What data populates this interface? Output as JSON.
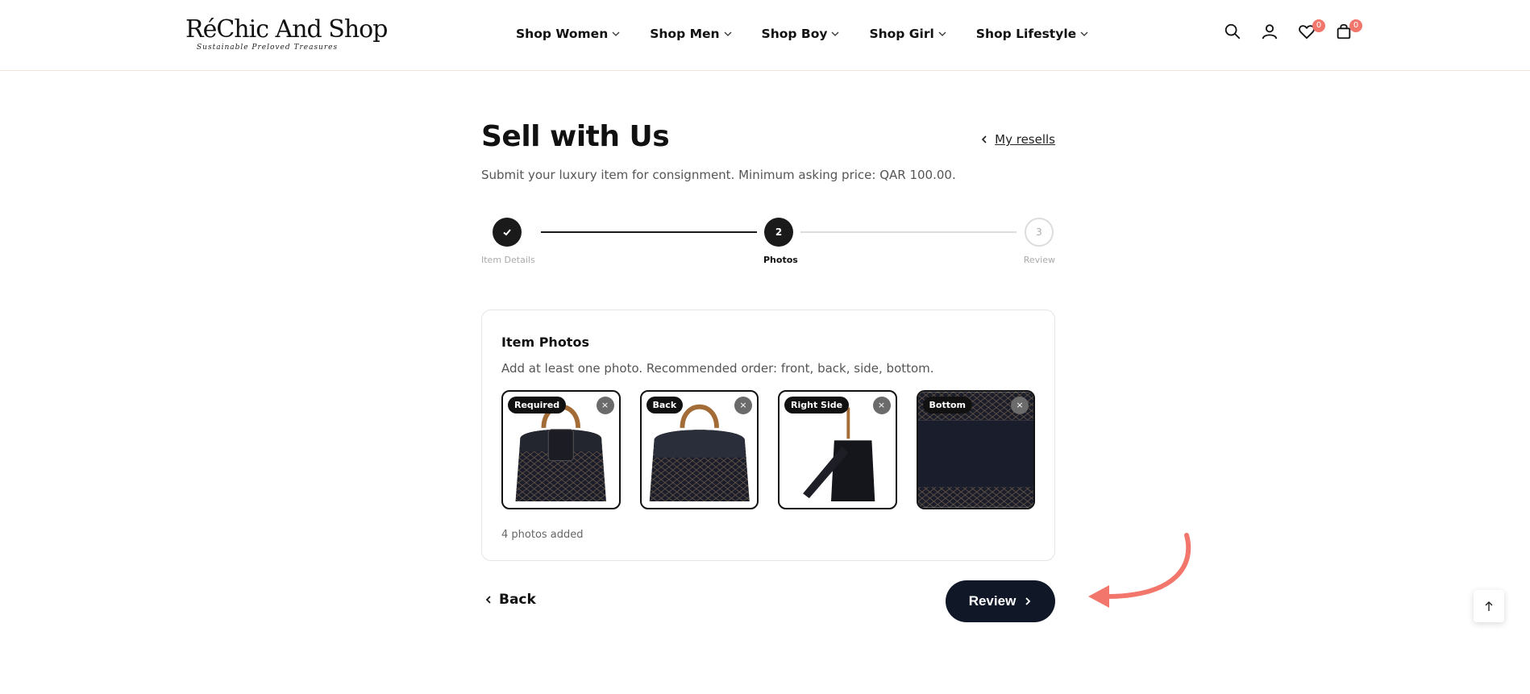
{
  "header": {
    "logo_title": "RéChic And Shop",
    "logo_tagline": "Sustainable Preloved Treasures",
    "nav": [
      {
        "label": "Shop Women"
      },
      {
        "label": "Shop Men"
      },
      {
        "label": "Shop Boy"
      },
      {
        "label": "Shop Girl"
      },
      {
        "label": "Shop Lifestyle"
      }
    ],
    "wishlist_count": "0",
    "cart_count": "0"
  },
  "page": {
    "title": "Sell with Us",
    "my_resells_link": "My resells",
    "subtitle": "Submit your luxury item for consignment. Minimum asking price: QAR 100.00."
  },
  "stepper": {
    "steps": [
      {
        "number": "1",
        "label": "Item Details",
        "state": "done"
      },
      {
        "number": "2",
        "label": "Photos",
        "state": "active"
      },
      {
        "number": "3",
        "label": "Review",
        "state": "pending"
      }
    ]
  },
  "photos_card": {
    "title": "Item Photos",
    "instructions": "Add at least one photo. Recommended order: front, back, side, bottom.",
    "photos": [
      {
        "tag": "Required",
        "remove": "×"
      },
      {
        "tag": "Back",
        "remove": "×"
      },
      {
        "tag": "Right Side",
        "remove": "×"
      },
      {
        "tag": "Bottom",
        "remove": "×"
      }
    ],
    "count_text": "4 photos added"
  },
  "actions": {
    "back_label": "Back",
    "review_label": "Review"
  },
  "colors": {
    "primary_dark": "#101828",
    "accent_badge": "#f2766b",
    "annotation_arrow": "#f2766b"
  }
}
